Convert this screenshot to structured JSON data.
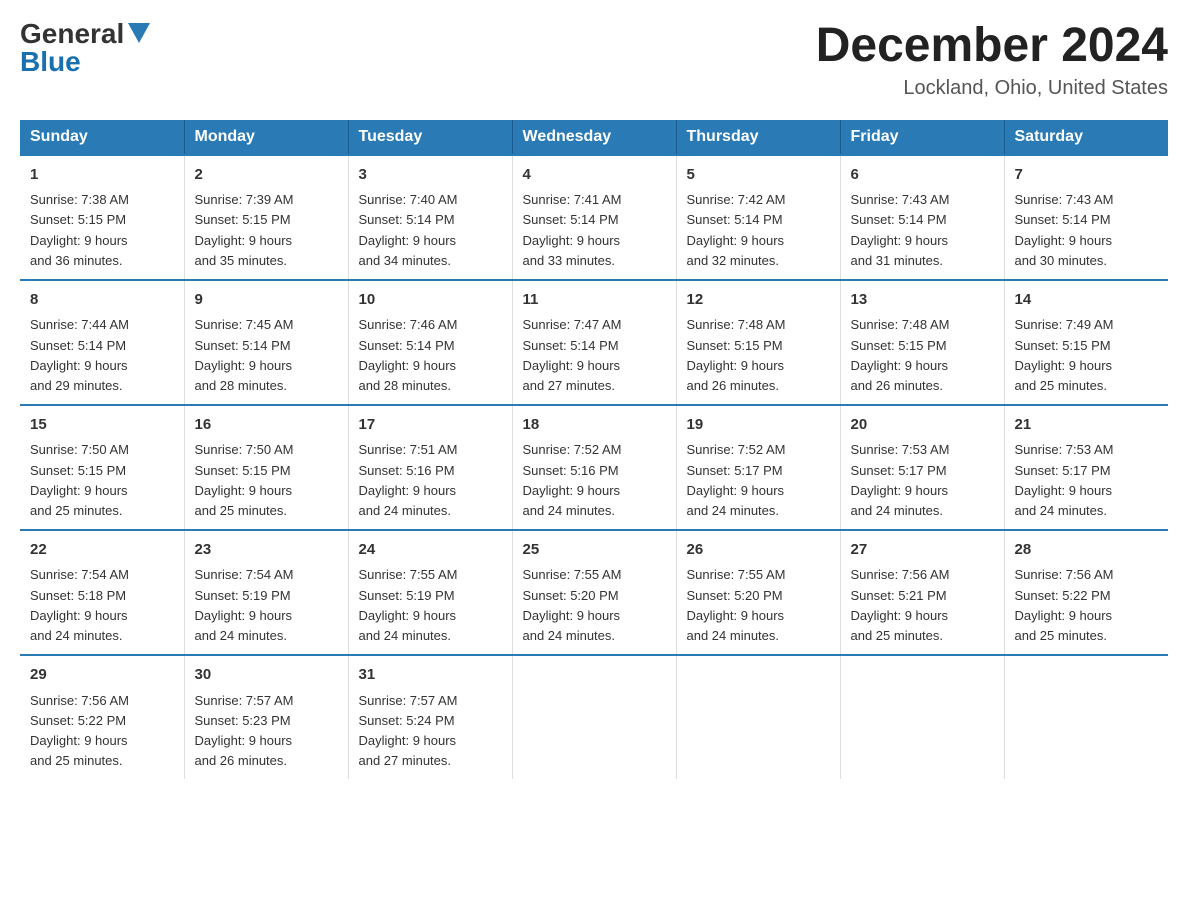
{
  "header": {
    "logo_general": "General",
    "logo_blue": "Blue",
    "month_title": "December 2024",
    "location": "Lockland, Ohio, United States"
  },
  "days_of_week": [
    "Sunday",
    "Monday",
    "Tuesday",
    "Wednesday",
    "Thursday",
    "Friday",
    "Saturday"
  ],
  "weeks": [
    [
      {
        "day": "1",
        "sunrise": "7:38 AM",
        "sunset": "5:15 PM",
        "daylight": "9 hours and 36 minutes."
      },
      {
        "day": "2",
        "sunrise": "7:39 AM",
        "sunset": "5:15 PM",
        "daylight": "9 hours and 35 minutes."
      },
      {
        "day": "3",
        "sunrise": "7:40 AM",
        "sunset": "5:14 PM",
        "daylight": "9 hours and 34 minutes."
      },
      {
        "day": "4",
        "sunrise": "7:41 AM",
        "sunset": "5:14 PM",
        "daylight": "9 hours and 33 minutes."
      },
      {
        "day": "5",
        "sunrise": "7:42 AM",
        "sunset": "5:14 PM",
        "daylight": "9 hours and 32 minutes."
      },
      {
        "day": "6",
        "sunrise": "7:43 AM",
        "sunset": "5:14 PM",
        "daylight": "9 hours and 31 minutes."
      },
      {
        "day": "7",
        "sunrise": "7:43 AM",
        "sunset": "5:14 PM",
        "daylight": "9 hours and 30 minutes."
      }
    ],
    [
      {
        "day": "8",
        "sunrise": "7:44 AM",
        "sunset": "5:14 PM",
        "daylight": "9 hours and 29 minutes."
      },
      {
        "day": "9",
        "sunrise": "7:45 AM",
        "sunset": "5:14 PM",
        "daylight": "9 hours and 28 minutes."
      },
      {
        "day": "10",
        "sunrise": "7:46 AM",
        "sunset": "5:14 PM",
        "daylight": "9 hours and 28 minutes."
      },
      {
        "day": "11",
        "sunrise": "7:47 AM",
        "sunset": "5:14 PM",
        "daylight": "9 hours and 27 minutes."
      },
      {
        "day": "12",
        "sunrise": "7:48 AM",
        "sunset": "5:15 PM",
        "daylight": "9 hours and 26 minutes."
      },
      {
        "day": "13",
        "sunrise": "7:48 AM",
        "sunset": "5:15 PM",
        "daylight": "9 hours and 26 minutes."
      },
      {
        "day": "14",
        "sunrise": "7:49 AM",
        "sunset": "5:15 PM",
        "daylight": "9 hours and 25 minutes."
      }
    ],
    [
      {
        "day": "15",
        "sunrise": "7:50 AM",
        "sunset": "5:15 PM",
        "daylight": "9 hours and 25 minutes."
      },
      {
        "day": "16",
        "sunrise": "7:50 AM",
        "sunset": "5:15 PM",
        "daylight": "9 hours and 25 minutes."
      },
      {
        "day": "17",
        "sunrise": "7:51 AM",
        "sunset": "5:16 PM",
        "daylight": "9 hours and 24 minutes."
      },
      {
        "day": "18",
        "sunrise": "7:52 AM",
        "sunset": "5:16 PM",
        "daylight": "9 hours and 24 minutes."
      },
      {
        "day": "19",
        "sunrise": "7:52 AM",
        "sunset": "5:17 PM",
        "daylight": "9 hours and 24 minutes."
      },
      {
        "day": "20",
        "sunrise": "7:53 AM",
        "sunset": "5:17 PM",
        "daylight": "9 hours and 24 minutes."
      },
      {
        "day": "21",
        "sunrise": "7:53 AM",
        "sunset": "5:17 PM",
        "daylight": "9 hours and 24 minutes."
      }
    ],
    [
      {
        "day": "22",
        "sunrise": "7:54 AM",
        "sunset": "5:18 PM",
        "daylight": "9 hours and 24 minutes."
      },
      {
        "day": "23",
        "sunrise": "7:54 AM",
        "sunset": "5:19 PM",
        "daylight": "9 hours and 24 minutes."
      },
      {
        "day": "24",
        "sunrise": "7:55 AM",
        "sunset": "5:19 PM",
        "daylight": "9 hours and 24 minutes."
      },
      {
        "day": "25",
        "sunrise": "7:55 AM",
        "sunset": "5:20 PM",
        "daylight": "9 hours and 24 minutes."
      },
      {
        "day": "26",
        "sunrise": "7:55 AM",
        "sunset": "5:20 PM",
        "daylight": "9 hours and 24 minutes."
      },
      {
        "day": "27",
        "sunrise": "7:56 AM",
        "sunset": "5:21 PM",
        "daylight": "9 hours and 25 minutes."
      },
      {
        "day": "28",
        "sunrise": "7:56 AM",
        "sunset": "5:22 PM",
        "daylight": "9 hours and 25 minutes."
      }
    ],
    [
      {
        "day": "29",
        "sunrise": "7:56 AM",
        "sunset": "5:22 PM",
        "daylight": "9 hours and 25 minutes."
      },
      {
        "day": "30",
        "sunrise": "7:57 AM",
        "sunset": "5:23 PM",
        "daylight": "9 hours and 26 minutes."
      },
      {
        "day": "31",
        "sunrise": "7:57 AM",
        "sunset": "5:24 PM",
        "daylight": "9 hours and 27 minutes."
      },
      null,
      null,
      null,
      null
    ]
  ],
  "labels": {
    "sunrise": "Sunrise:",
    "sunset": "Sunset:",
    "daylight": "Daylight:"
  }
}
